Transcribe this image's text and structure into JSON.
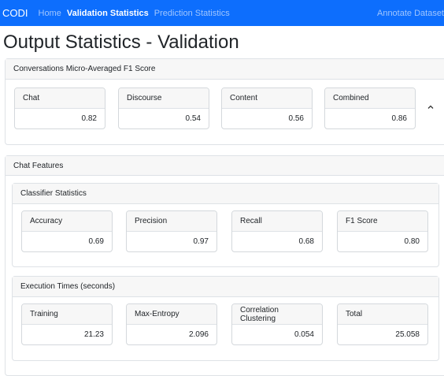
{
  "navbar": {
    "brand": "CODI",
    "links": [
      "Home",
      "Validation Statistics",
      "Prediction Statistics"
    ],
    "right_link": "Annotate Dataset",
    "bg_color": "#0d6efd"
  },
  "page_title": "Output Statistics - Validation",
  "f1_card": {
    "header": "Conversations Micro-Averaged F1 Score",
    "stats": [
      {
        "label": "Chat",
        "value": "0.82"
      },
      {
        "label": "Discourse",
        "value": "0.54"
      },
      {
        "label": "Content",
        "value": "0.56"
      },
      {
        "label": "Combined",
        "value": "0.86"
      }
    ],
    "collapse_icon": "chevron-up-icon"
  },
  "chat_features": {
    "header": "Chat Features",
    "classifier": {
      "header": "Classifier Statistics",
      "stats": [
        {
          "label": "Accuracy",
          "value": "0.69"
        },
        {
          "label": "Precision",
          "value": "0.97"
        },
        {
          "label": "Recall",
          "value": "0.68"
        },
        {
          "label": "F1 Score",
          "value": "0.80"
        }
      ]
    },
    "execution": {
      "header": "Execution Times (seconds)",
      "stats": [
        {
          "label": "Training",
          "value": "21.23"
        },
        {
          "label": "Max-Entropy",
          "value": "2.096"
        },
        {
          "label": "Correlation Clustering",
          "value": "0.054"
        },
        {
          "label": "Total",
          "value": "25.058"
        }
      ]
    }
  }
}
